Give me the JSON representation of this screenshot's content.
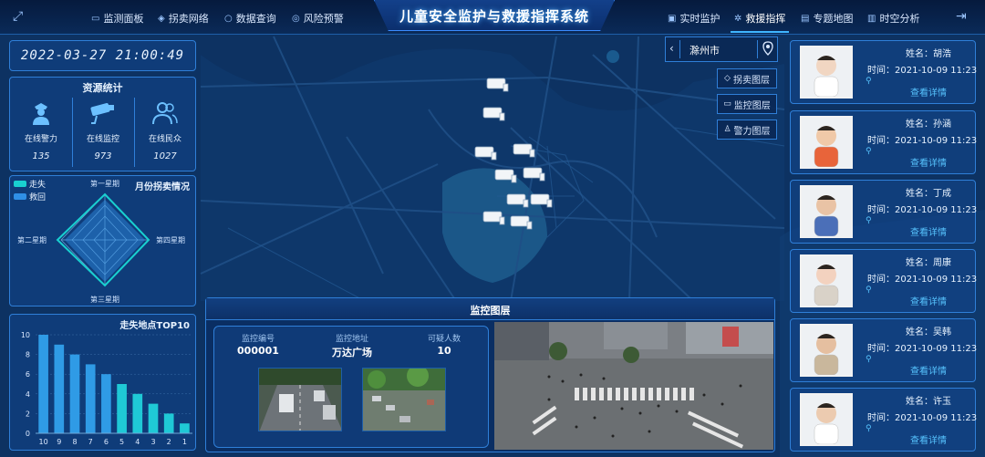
{
  "header": {
    "title": "儿童安全监护与救援指挥系统",
    "nav_left": [
      {
        "label": "监测面板",
        "icon": "monitor-icon"
      },
      {
        "label": "拐卖网络",
        "icon": "network-icon"
      },
      {
        "label": "数据查询",
        "icon": "search-icon"
      },
      {
        "label": "风险预警",
        "icon": "warning-icon"
      }
    ],
    "nav_right": [
      {
        "label": "实时监护",
        "icon": "monitor-icon"
      },
      {
        "label": "救援指挥",
        "icon": "command-icon"
      },
      {
        "label": "专题地图",
        "icon": "map-icon"
      },
      {
        "label": "时空分析",
        "icon": "analysis-icon"
      }
    ],
    "active_nav": "救援指挥"
  },
  "datetime": "2022-03-27 21:00:49",
  "resources": {
    "title": "资源统计",
    "items": [
      {
        "label": "在线警力",
        "value": "135",
        "icon": "police-icon"
      },
      {
        "label": "在线监控",
        "value": "973",
        "icon": "camera-icon"
      },
      {
        "label": "在线民众",
        "value": "1027",
        "icon": "people-icon"
      }
    ]
  },
  "radar": {
    "title": "月份拐卖情况",
    "legend": [
      {
        "name": "走失",
        "color": "#19d0d0"
      },
      {
        "name": "救回",
        "color": "#2f8fe6"
      }
    ],
    "axes": [
      "第一星期",
      "第二星期",
      "第三星期",
      "第四星期"
    ]
  },
  "bar": {
    "title": "走失地点TOP10"
  },
  "chart_data": {
    "type": "bar",
    "title": "走失地点TOP10",
    "categories": [
      "10",
      "9",
      "8",
      "7",
      "6",
      "5",
      "4",
      "3",
      "2",
      "1"
    ],
    "values": [
      10,
      9,
      8,
      7,
      6,
      5,
      4,
      3,
      2,
      1
    ],
    "ylim": [
      0,
      10
    ],
    "yticks": [
      0,
      2,
      4,
      6,
      8,
      10
    ]
  },
  "map": {
    "city": "滁州市",
    "layers": [
      "拐卖图层",
      "监控图层",
      "警力图层"
    ]
  },
  "monitor": {
    "title": "监控图层",
    "id_label": "监控编号",
    "id_value": "000001",
    "addr_label": "监控地址",
    "addr_value": "万达广场",
    "count_label": "可疑人数",
    "count_value": "10"
  },
  "persons": [
    {
      "name": "姓名：胡浩",
      "time": "时间：2021-10-09 11:23",
      "detail": "查看详情"
    },
    {
      "name": "姓名：孙涵",
      "time": "时间：2021-10-09 11:23",
      "detail": "查看详情"
    },
    {
      "name": "姓名：丁成",
      "time": "时间：2021-10-09 11:23",
      "detail": "查看详情"
    },
    {
      "name": "姓名：周康",
      "time": "时间：2021-10-09 11:23",
      "detail": "查看详情"
    },
    {
      "name": "姓名：吴韩",
      "time": "时间：2021-10-09 11:23",
      "detail": "查看详情"
    },
    {
      "name": "姓名：许玉",
      "time": "时间：2021-10-09 11:23",
      "detail": "查看详情"
    }
  ]
}
